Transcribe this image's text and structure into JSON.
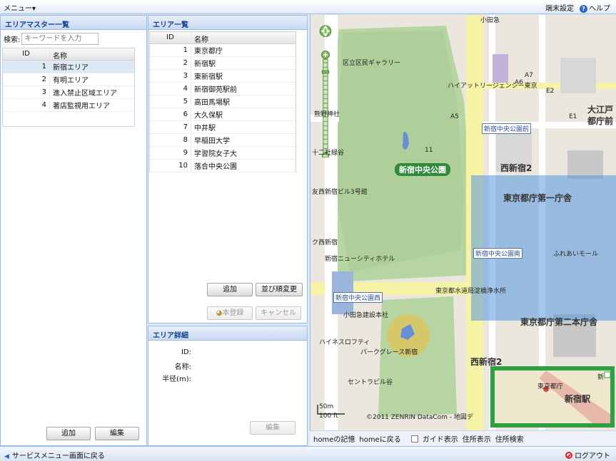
{
  "topbar": {
    "menu": "メニュー▾",
    "terminal_settings": "端末設定",
    "help": "ヘルプ"
  },
  "master": {
    "title": "エリアマスター一覧",
    "search_label": "検索:",
    "search_placeholder": "キーワードを入力",
    "col_id": "ID",
    "col_name": "名称",
    "rows": [
      {
        "id": "1",
        "name": "新宿エリア"
      },
      {
        "id": "2",
        "name": "有明エリア"
      },
      {
        "id": "3",
        "name": "進入禁止区域エリア"
      },
      {
        "id": "4",
        "name": "著店監視用エリア"
      }
    ],
    "add": "追加",
    "edit": "編集"
  },
  "area_list": {
    "title": "エリア一覧",
    "col_id": "ID",
    "col_name": "名称",
    "rows": [
      {
        "id": "1",
        "name": "東京都庁"
      },
      {
        "id": "2",
        "name": "新宿駅"
      },
      {
        "id": "3",
        "name": "東新宿駅"
      },
      {
        "id": "4",
        "name": "新宿御苑駅前"
      },
      {
        "id": "5",
        "name": "高田馬場駅"
      },
      {
        "id": "6",
        "name": "大久保駅"
      },
      {
        "id": "7",
        "name": "中井駅"
      },
      {
        "id": "8",
        "name": "早稲田大学"
      },
      {
        "id": "9",
        "name": "学習院女子大"
      },
      {
        "id": "10",
        "name": "落合中央公園"
      }
    ],
    "add": "追加",
    "reorder": "並び順変更",
    "register": "本登録",
    "cancel": "キャンセル"
  },
  "detail": {
    "title": "エリア詳細",
    "id_label": "ID:",
    "name_label": "名称:",
    "radius_label": "半径(m):",
    "edit": "編集"
  },
  "map": {
    "labels": {
      "gallery": "区立区民ギャラリー",
      "hyatt": "ハイアットリージェンシー東京",
      "kumano": "熊野神社",
      "juniso": "十二社緑谷",
      "park": "新宿中央公園",
      "park_front": "新宿中央公園前",
      "park_south": "新宿中央公園南",
      "park_west": "新宿中央公園西",
      "nishishinjuku2": "西新宿2",
      "nishishinjuku2b": "西新宿2",
      "tocho1": "東京都庁第一庁舎",
      "tocho2": "東京都庁第二本庁舎",
      "fureai": "ふれあいモール",
      "nct_hotel": "新宿ニューシティホテル",
      "odakyu": "小田急建設本社",
      "suido": "東京都水道局淀橋浄水所",
      "park_grace": "パークグレース新宿",
      "haines": "ハイネスロフティ",
      "seven": "セントラビル谷",
      "tomo": "友西新宿ビル3号館",
      "ooedo": "大江戸",
      "ooedo2": "都庁前",
      "odakyu_soba": "小田急",
      "nishishinjuku_k": "ク西新宿",
      "a5": "A5",
      "a6": "A6",
      "a7": "A7",
      "e1": "E1",
      "e2": "E2",
      "num11": "11",
      "mini_tocho": "東京都庁",
      "mini_station": "新宿駅",
      "mini_shin": "新",
      "scale_m": "50m",
      "scale_ft": "100 ft",
      "copyright": "©2011 ZENRIN DataCom - 地図デ"
    }
  },
  "map_footer": {
    "home_memo": "homeの記憶",
    "home_return": "homeに戻る",
    "guide": "ガイド表示",
    "address_show": "住所表示",
    "address_search": "住所検索"
  },
  "bottombar": {
    "back": "サービスメニュー画面に戻る",
    "logout": "ログアウト"
  },
  "colors": {
    "accent": "#15428b",
    "border": "#99bbe8",
    "park_green": "#2f8a3b",
    "highlight": "#4a90e2",
    "minimap_border": "#2ea043"
  }
}
